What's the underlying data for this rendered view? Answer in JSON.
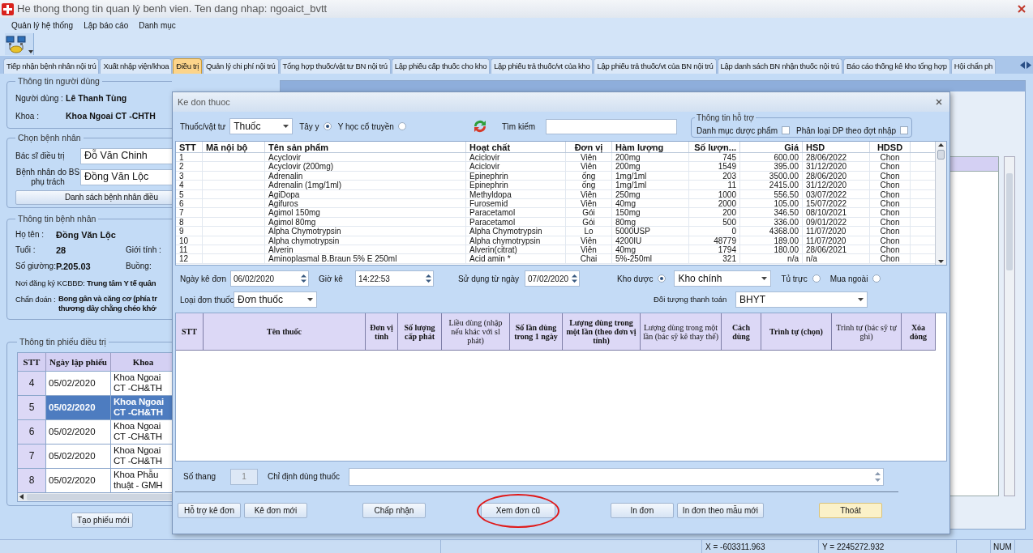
{
  "window": {
    "title": "He thong thong tin quan lý benh vien. Ten dang nhap: ngoaict_bvtt"
  },
  "menu": [
    "Quản lý hệ thống",
    "Lập báo cáo",
    "Danh mục"
  ],
  "tabs": [
    {
      "label": "Tiếp nhận bệnh nhân nội trú",
      "selected": false
    },
    {
      "label": "Xuất nhập viện/khoa",
      "selected": false
    },
    {
      "label": "Điều trị",
      "selected": true
    },
    {
      "label": "Quản lý chi phí nội trú",
      "selected": false
    },
    {
      "label": "Tổng hợp thuốc/vật tư BN nội trú",
      "selected": false
    },
    {
      "label": "Lập phiếu cấp thuốc cho kho",
      "selected": false
    },
    {
      "label": "Lập phiếu trả thuốc/vt của kho",
      "selected": false
    },
    {
      "label": "Lập phiếu trả thuốc/vt của BN nội trú",
      "selected": false
    },
    {
      "label": "Lập danh sách BN nhận thuốc nội trú",
      "selected": false
    },
    {
      "label": "Báo cáo thống kê kho tổng hợp",
      "selected": false
    },
    {
      "label": "Hội chẩn ph",
      "selected": false
    }
  ],
  "user_info": {
    "title": "Thông tin người dùng",
    "fields": [
      {
        "label": "Người dùng :",
        "value": "Lê Thanh Tùng"
      },
      {
        "label": "Khoa :",
        "value": "Khoa Ngoai CT -CHTH"
      }
    ]
  },
  "choose_patient": {
    "title": "Chọn bệnh nhân",
    "doctor_label": "Bác sĩ điều trị",
    "doctor": "Đỗ Văn Chinh",
    "patient_label": "Bệnh nhân do BS phụ trách",
    "patient": "Đồng Văn Lộc",
    "list_button": "Danh sách bệnh nhân điều"
  },
  "patient_info": {
    "title": "Thông tin bệnh nhân",
    "name_label": "Họ tên :",
    "name": "Đồng Văn Lộc",
    "age_label": "Tuổi :",
    "age": "28",
    "sex_label": "Giới tính :",
    "bed_label": "Số giường:",
    "bed": "P.205.03",
    "room_label": "Buồng:",
    "register_label": "Nơi đăng ký KCBBĐ:",
    "register": "Trung tâm Y tế quân",
    "diagnosis_label": "Chẩn đoán :",
    "diagnosis_lines": [
      "Bong gân và căng cơ (phía tr",
      "thương dây chằng chéo khớ"
    ]
  },
  "treatment_sheets": {
    "title": "Thông tin phiếu điều trị",
    "columns": [
      "STT",
      "Ngày lập phiếu",
      "Khoa"
    ],
    "rows": [
      {
        "stt": "4",
        "date": "05/02/2020",
        "dept": "Khoa Ngoai CT -CH&TH",
        "selected": false
      },
      {
        "stt": "5",
        "date": "05/02/2020",
        "dept": "Khoa Ngoai CT -CH&TH",
        "selected": true
      },
      {
        "stt": "6",
        "date": "05/02/2020",
        "dept": "Khoa Ngoai CT -CH&TH",
        "selected": false
      },
      {
        "stt": "7",
        "date": "05/02/2020",
        "dept": "Khoa Ngoai CT -CH&TH",
        "selected": false
      },
      {
        "stt": "8",
        "date": "05/02/2020",
        "dept": "Khoa Phẫu thuật - GMH",
        "selected": false
      }
    ]
  },
  "new_sheet_button": "Tạo phiếu mới",
  "dialog": {
    "title": "Ke don thuoc",
    "type_label": "Thuốc/vật tư",
    "type_value": "Thuốc",
    "medicine_options": [
      {
        "label": "Tây y",
        "selected": true
      },
      {
        "label": "Y học cổ truyền",
        "selected": false
      }
    ],
    "search_label": "Tìm kiếm",
    "support": {
      "title": "Thông tin hỗ trợ",
      "options": [
        {
          "label": "Danh mục dược phẩm",
          "checked": false
        },
        {
          "label": "Phân loại DP theo đợt nhập",
          "checked": false
        }
      ]
    },
    "drug_table": {
      "columns": [
        "STT",
        "Mã nội bộ",
        "Tên sản phẩm",
        "Hoạt chất",
        "Đơn vị",
        "Hàm lượng",
        "Số lượn...",
        "Giá",
        "HSD",
        "HDSD"
      ],
      "rows": [
        {
          "stt": "1",
          "name": "Acyclovir",
          "ingredient": "Aciclovir",
          "unit": "Viên",
          "strength": "200mg",
          "qty": "745",
          "price": "600.00",
          "expiry": "28/06/2022",
          "usage": "Chon"
        },
        {
          "stt": "2",
          "name": "Acyclovir (200mg)",
          "ingredient": "Aciclovir",
          "unit": "Viên",
          "strength": "200mg",
          "qty": "1549",
          "price": "395.00",
          "expiry": "31/12/2020",
          "usage": "Chon"
        },
        {
          "stt": "3",
          "name": "Adrenalin",
          "ingredient": "Epinephrin",
          "unit": "ống",
          "strength": "1mg/1ml",
          "qty": "203",
          "price": "3500.00",
          "expiry": "28/06/2020",
          "usage": "Chon"
        },
        {
          "stt": "4",
          "name": "Adrenalin (1mg/1ml)",
          "ingredient": "Epinephrin",
          "unit": "ống",
          "strength": "1mg/1ml",
          "qty": "11",
          "price": "2415.00",
          "expiry": "31/12/2020",
          "usage": "Chon"
        },
        {
          "stt": "5",
          "name": "AgiDopa",
          "ingredient": "Methyldopa",
          "unit": "Viên",
          "strength": "250mg",
          "qty": "1000",
          "price": "556.50",
          "expiry": "03/07/2022",
          "usage": "Chon"
        },
        {
          "stt": "6",
          "name": "Agifuros",
          "ingredient": "Furosemid",
          "unit": "Viên",
          "strength": "40mg",
          "qty": "2000",
          "price": "105.00",
          "expiry": "15/07/2022",
          "usage": "Chon"
        },
        {
          "stt": "7",
          "name": "Agimol 150mg",
          "ingredient": "Paracetamol",
          "unit": "Gói",
          "strength": "150mg",
          "qty": "200",
          "price": "346.50",
          "expiry": "08/10/2021",
          "usage": "Chon"
        },
        {
          "stt": "8",
          "name": "Agimol 80mg",
          "ingredient": "Paracetamol",
          "unit": "Gói",
          "strength": "80mg",
          "qty": "500",
          "price": "336.00",
          "expiry": "09/01/2022",
          "usage": "Chon"
        },
        {
          "stt": "9",
          "name": "Alpha Chymotrypsin",
          "ingredient": "Alpha Chymotrypsin",
          "unit": "Lo",
          "strength": "5000USP",
          "qty": "0",
          "price": "4368.00",
          "expiry": "11/07/2020",
          "usage": "Chon"
        },
        {
          "stt": "10",
          "name": "Alpha chymotrypsin",
          "ingredient": "Alpha chymotrypsin",
          "unit": "Viên",
          "strength": "4200IU",
          "qty": "48779",
          "price": "189.00",
          "expiry": "11/07/2020",
          "usage": "Chon"
        },
        {
          "stt": "11",
          "name": "Alverin",
          "ingredient": "Alverin(citrat)",
          "unit": "Viên",
          "strength": "40mg",
          "qty": "1794",
          "price": "180.00",
          "expiry": "28/06/2021",
          "usage": "Chon"
        },
        {
          "stt": "12",
          "name": "Aminoplasmal B.Braun 5% E 250ml",
          "ingredient": "Acid amin *",
          "unit": "Chai",
          "strength": "5%-250ml",
          "qty": "321",
          "price": "n/a",
          "expiry": "n/a",
          "usage": "Chon"
        }
      ]
    },
    "date_label": "Ngày kê đơn",
    "date": "06/02/2020",
    "time_label": "Giờ kê",
    "time": "14:22:53",
    "use_from_label": "Sử dụng từ ngày",
    "use_from": "07/02/2020",
    "stores": [
      {
        "label": "Kho dược",
        "selected": true
      },
      {
        "label": "Tủ trực",
        "selected": false
      },
      {
        "label": "Mua ngoài",
        "selected": false
      }
    ],
    "store_value": "Kho chính",
    "rx_type_label": "Loại đơn thuốc",
    "rx_type": "Đơn thuốc",
    "payer_label": "Đối tượng thanh toán",
    "payer": "BHYT",
    "rx_columns": [
      {
        "label": "STT",
        "bold": true
      },
      {
        "label": "Tên thuốc",
        "bold": true
      },
      {
        "label": "Đơn vị tính",
        "bold": true
      },
      {
        "label": "Số lượng cấp phát",
        "bold": true
      },
      {
        "label": "Liều dùng (nhập nếu khác với sl phát)",
        "bold": false
      },
      {
        "label": "Số lần dùng trong 1 ngày",
        "bold": true
      },
      {
        "label": "Lượng dùng trong một lần (theo đơn vị tính)",
        "bold": true
      },
      {
        "label": "Lượng dùng trong một lần (bác sỹ kê thay thế)",
        "bold": false
      },
      {
        "label": "Cách dùng",
        "bold": true
      },
      {
        "label": "Trình tự (chọn)",
        "bold": true
      },
      {
        "label": "Trình tự (bác sỹ tự ghi)",
        "bold": false
      },
      {
        "label": "Xóa dòng",
        "bold": true
      }
    ],
    "dose_count_label": "Số thang",
    "dose_count": "1",
    "instruction_label": "Chỉ định dùng thuốc",
    "button_groups": [
      [
        {
          "label": "Hỗ trợ kê đơn",
          "focused": false,
          "circled": false
        },
        {
          "label": "Kê đơn mới",
          "focused": false,
          "circled": false
        }
      ],
      [
        {
          "label": "Chấp nhận",
          "focused": false,
          "circled": false
        }
      ],
      [
        {
          "label": "Xem đơn cũ",
          "focused": false,
          "circled": true
        }
      ],
      [
        {
          "label": "In đơn",
          "focused": false,
          "circled": false
        },
        {
          "label": "In đơn theo mẫu mới",
          "focused": false,
          "circled": false
        }
      ],
      [
        {
          "label": "Thoát",
          "focused": true,
          "circled": false
        }
      ]
    ]
  },
  "status_bar": [
    "X = -603311.963",
    "Y = 2245272.932",
    "NUM"
  ]
}
